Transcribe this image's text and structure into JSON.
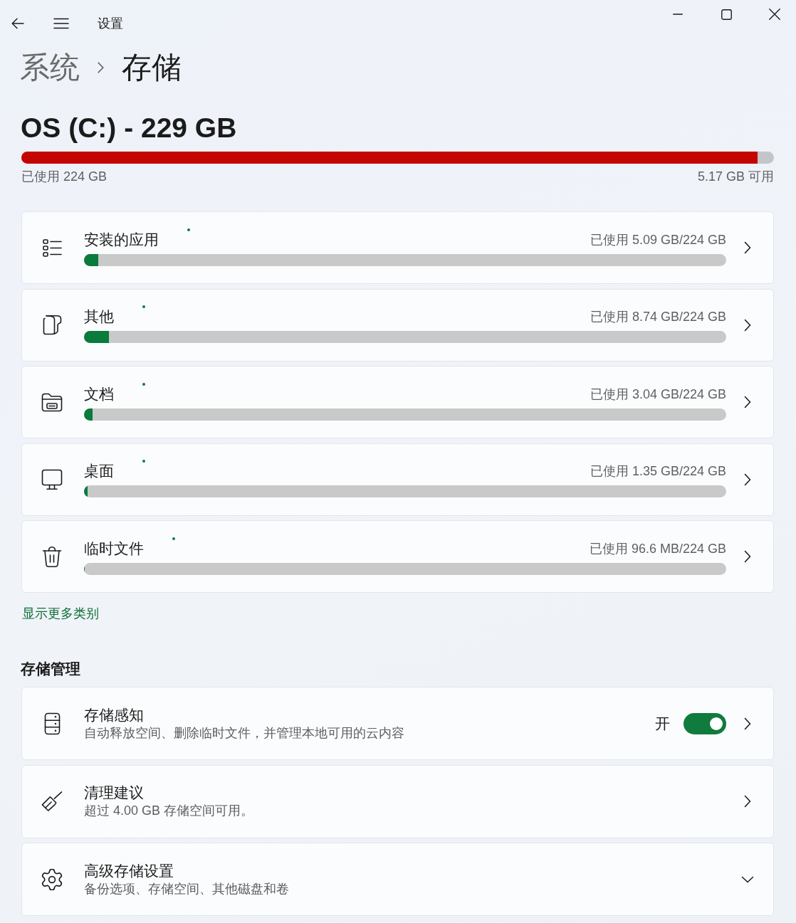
{
  "window": {
    "title": "设置"
  },
  "breadcrumb": [
    {
      "label": "系统",
      "current": false
    },
    {
      "label": "存储",
      "current": true
    }
  ],
  "drive": {
    "title": "OS (C:) - 229 GB",
    "level": 0.978,
    "used": "已使用 224 GB",
    "free": "5.17 GB 可用"
  },
  "categories": [
    {
      "name": "安装的应用",
      "usage": "已使用 5.09 GB/224 GB",
      "level": 0.0227
    },
    {
      "name": "其他",
      "usage": "已使用 8.74 GB/224 GB",
      "level": 0.039
    },
    {
      "name": "文档",
      "usage": "已使用 3.04 GB/224 GB",
      "level": 0.0136
    },
    {
      "name": "桌面",
      "usage": "已使用 1.35 GB/224 GB",
      "level": 0.006
    },
    {
      "name": "临时文件",
      "usage": "已使用 96.6 MB/224 GB",
      "level": 0.0004
    }
  ],
  "show_more": "显示更多类别",
  "management": {
    "heading": "存储管理",
    "items": [
      {
        "kind": "toggle",
        "title": "存储感知",
        "subtitle": "自动释放空间、删除临时文件，并管理本地可用的云内容",
        "state_label": "开",
        "on": true
      },
      {
        "kind": "link",
        "title": "清理建议",
        "subtitle": "超过 4.00 GB 存储空间可用。"
      },
      {
        "kind": "expander",
        "title": "高级存储设置",
        "subtitle": "备份选项、存储空间、其他磁盘和卷",
        "expanded": false
      }
    ]
  }
}
